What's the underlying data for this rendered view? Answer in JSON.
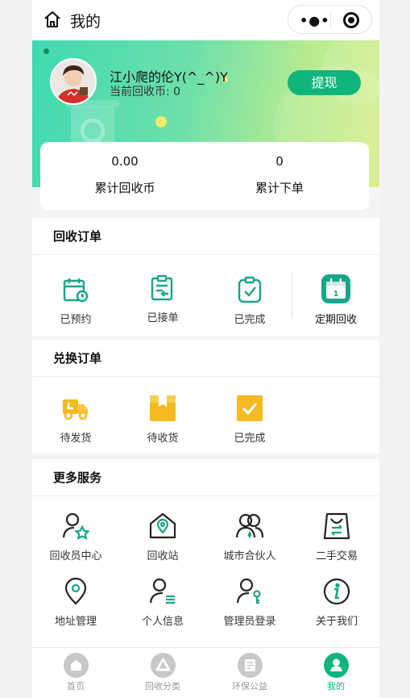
{
  "nav": {
    "title": "我的"
  },
  "user": {
    "name": "江小爬的伦Y(^_^)Y",
    "coins_text": "当前回收币: 0",
    "withdraw_label": "提现"
  },
  "stats": [
    {
      "value": "0.00",
      "label": "累计回收币"
    },
    {
      "value": "0",
      "label": "累计下单"
    }
  ],
  "recycle_orders": {
    "title": "回收订单",
    "items": [
      {
        "label": "已预约",
        "icon": "calendar-clock-icon"
      },
      {
        "label": "已接单",
        "icon": "clipboard-receive-icon"
      },
      {
        "label": "已完成",
        "icon": "clipboard-check-icon"
      },
      {
        "label": "定期回收",
        "icon": "calendar-day-icon",
        "day": "1"
      }
    ]
  },
  "exchange_orders": {
    "title": "兑换订单",
    "items": [
      {
        "label": "待发货",
        "icon": "truck-icon"
      },
      {
        "label": "待收货",
        "icon": "box-icon"
      },
      {
        "label": "已完成",
        "icon": "check-box-icon"
      }
    ]
  },
  "more_services": {
    "title": "更多服务",
    "items": [
      {
        "label": "回收员中心",
        "icon": "user-star-icon"
      },
      {
        "label": "回收站",
        "icon": "house-pin-icon"
      },
      {
        "label": "城市合伙人",
        "icon": "partners-icon"
      },
      {
        "label": "二手交易",
        "icon": "shopping-bag-icon"
      },
      {
        "label": "地址管理",
        "icon": "location-pin-icon"
      },
      {
        "label": "个人信息",
        "icon": "user-list-icon"
      },
      {
        "label": "管理员登录",
        "icon": "user-key-icon"
      },
      {
        "label": "关于我们",
        "icon": "info-icon"
      }
    ]
  },
  "tabbar": [
    {
      "label": "首页",
      "icon": "home-tab-icon"
    },
    {
      "label": "回收分类",
      "icon": "recycle-tab-icon"
    },
    {
      "label": "环保公益",
      "icon": "notepad-tab-icon"
    },
    {
      "label": "我的",
      "icon": "user-tab-icon",
      "active": true
    }
  ],
  "colors": {
    "accent": "#10b57c",
    "icon_green": "#1aa588",
    "icon_yellow": "#f5b921"
  }
}
